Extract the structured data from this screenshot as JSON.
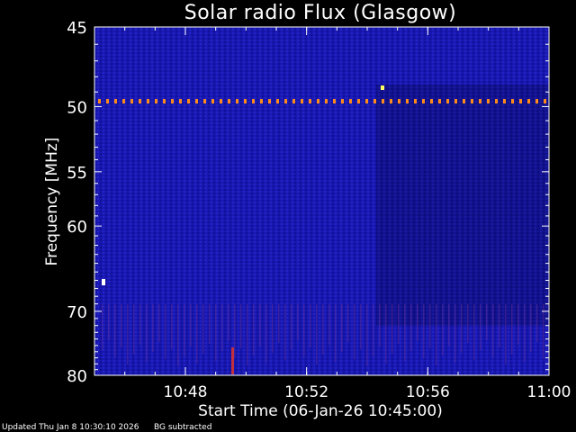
{
  "chart_data": {
    "type": "heatmap",
    "title": "Solar radio Flux (Glasgow)",
    "xlabel": "Start Time (06-Jan-26 10:45:00)",
    "ylabel": "Frequency [MHz]",
    "x_ticks": [
      "10:48",
      "10:52",
      "10:56",
      "11:00"
    ],
    "x_tick_values_minutes_after_start": [
      3,
      7,
      11,
      15
    ],
    "xlim_minutes_after_start": [
      0,
      15
    ],
    "y_ticks": [
      "45",
      "50",
      "55",
      "60",
      "70",
      "80"
    ],
    "y_tick_values_mhz": [
      45,
      50,
      55,
      60,
      70,
      80
    ],
    "ylim_mhz": [
      80,
      45
    ],
    "y_scale": "reciprocal",
    "colors": {
      "background": "#000000",
      "low": "#1a1ab4",
      "darker_block": "#101080",
      "interference": "#ff8c1a",
      "burst": "#ffff66",
      "axis": "#ffffff"
    },
    "features": [
      {
        "kind": "persistent-narrowband-line",
        "frequency_mhz": 49.6
      },
      {
        "kind": "time-block-dimmer",
        "from_minute": 9.3,
        "to_minute": 15,
        "from_mhz": 48.5,
        "to_mhz": 72
      }
    ]
  },
  "footer": {
    "updated": "Updated Thu Jan  8 10:30:10 2026",
    "bg_note": "BG subtracted"
  }
}
